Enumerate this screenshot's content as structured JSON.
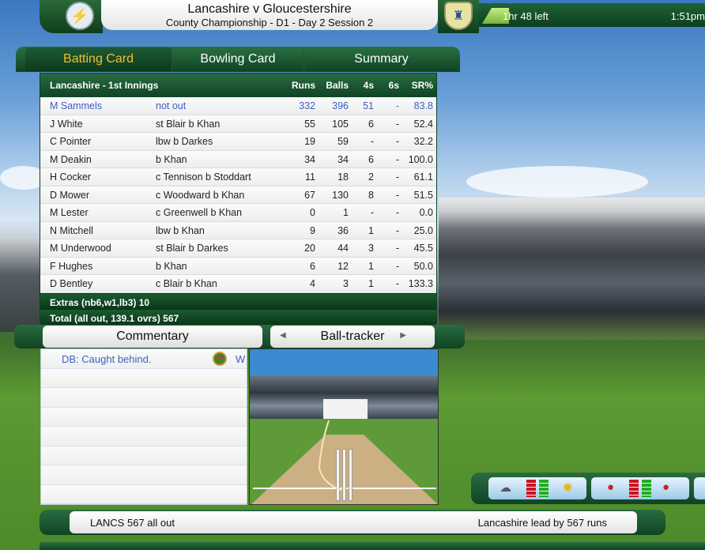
{
  "match": {
    "title": "Lancashire v Gloucestershire",
    "subtitle": "County Championship - D1 - Day 2 Session 2"
  },
  "session": {
    "time_left": "1hr 48 left",
    "clock": "1:51pm",
    "progress": 0.12
  },
  "tabs": [
    "Batting Card",
    "Bowling Card",
    "Summary"
  ],
  "card": {
    "innings": "Lancashire - 1st Innings",
    "headers": {
      "runs": "Runs",
      "balls": "Balls",
      "fours": "4s",
      "sixes": "6s",
      "sr": "SR%"
    },
    "rows": [
      {
        "name": "M Sammels",
        "how": "not out",
        "runs": "332",
        "balls": "396",
        "fours": "51",
        "sixes": "-",
        "sr": "83.8"
      },
      {
        "name": "J White",
        "how": "st Blair b Khan",
        "runs": "55",
        "balls": "105",
        "fours": "6",
        "sixes": "-",
        "sr": "52.4"
      },
      {
        "name": "C Pointer",
        "how": "lbw b Darkes",
        "runs": "19",
        "balls": "59",
        "fours": "-",
        "sixes": "-",
        "sr": "32.2"
      },
      {
        "name": "M Deakin",
        "how": "b Khan",
        "runs": "34",
        "balls": "34",
        "fours": "6",
        "sixes": "-",
        "sr": "100.0"
      },
      {
        "name": "H Cocker",
        "how": "c Tennison b Stoddart",
        "runs": "11",
        "balls": "18",
        "fours": "2",
        "sixes": "-",
        "sr": "61.1"
      },
      {
        "name": "D Mower",
        "how": "c Woodward b Khan",
        "runs": "67",
        "balls": "130",
        "fours": "8",
        "sixes": "-",
        "sr": "51.5"
      },
      {
        "name": "M Lester",
        "how": "c Greenwell b Khan",
        "runs": "0",
        "balls": "1",
        "fours": "-",
        "sixes": "-",
        "sr": "0.0"
      },
      {
        "name": "N Mitchell",
        "how": "lbw b Khan",
        "runs": "9",
        "balls": "36",
        "fours": "1",
        "sixes": "-",
        "sr": "25.0"
      },
      {
        "name": "M Underwood",
        "how": "st Blair b Darkes",
        "runs": "20",
        "balls": "44",
        "fours": "3",
        "sixes": "-",
        "sr": "45.5"
      },
      {
        "name": "F Hughes",
        "how": "b Khan",
        "runs": "6",
        "balls": "12",
        "fours": "1",
        "sixes": "-",
        "sr": "50.0"
      },
      {
        "name": "D Bentley",
        "how": "c Blair b Khan",
        "runs": "4",
        "balls": "3",
        "fours": "1",
        "sixes": "-",
        "sr": "133.3"
      }
    ],
    "extras": "Extras (nb6,w1,lb3) 10",
    "total": "Total (all out, 139.1 ovrs) 567"
  },
  "commentary": {
    "label": "Commentary",
    "ball_tracker_label": "Ball-tracker",
    "entries": [
      "DB:  Caught behind."
    ],
    "entry_suffix": "W"
  },
  "status": {
    "left": "LANCS  567 all out",
    "right": "Lancashire lead by 567 runs"
  },
  "colors": {
    "accent": "#f2c02b",
    "highlight_row": "#3d5fc2",
    "panel_green": "#0f4425"
  }
}
